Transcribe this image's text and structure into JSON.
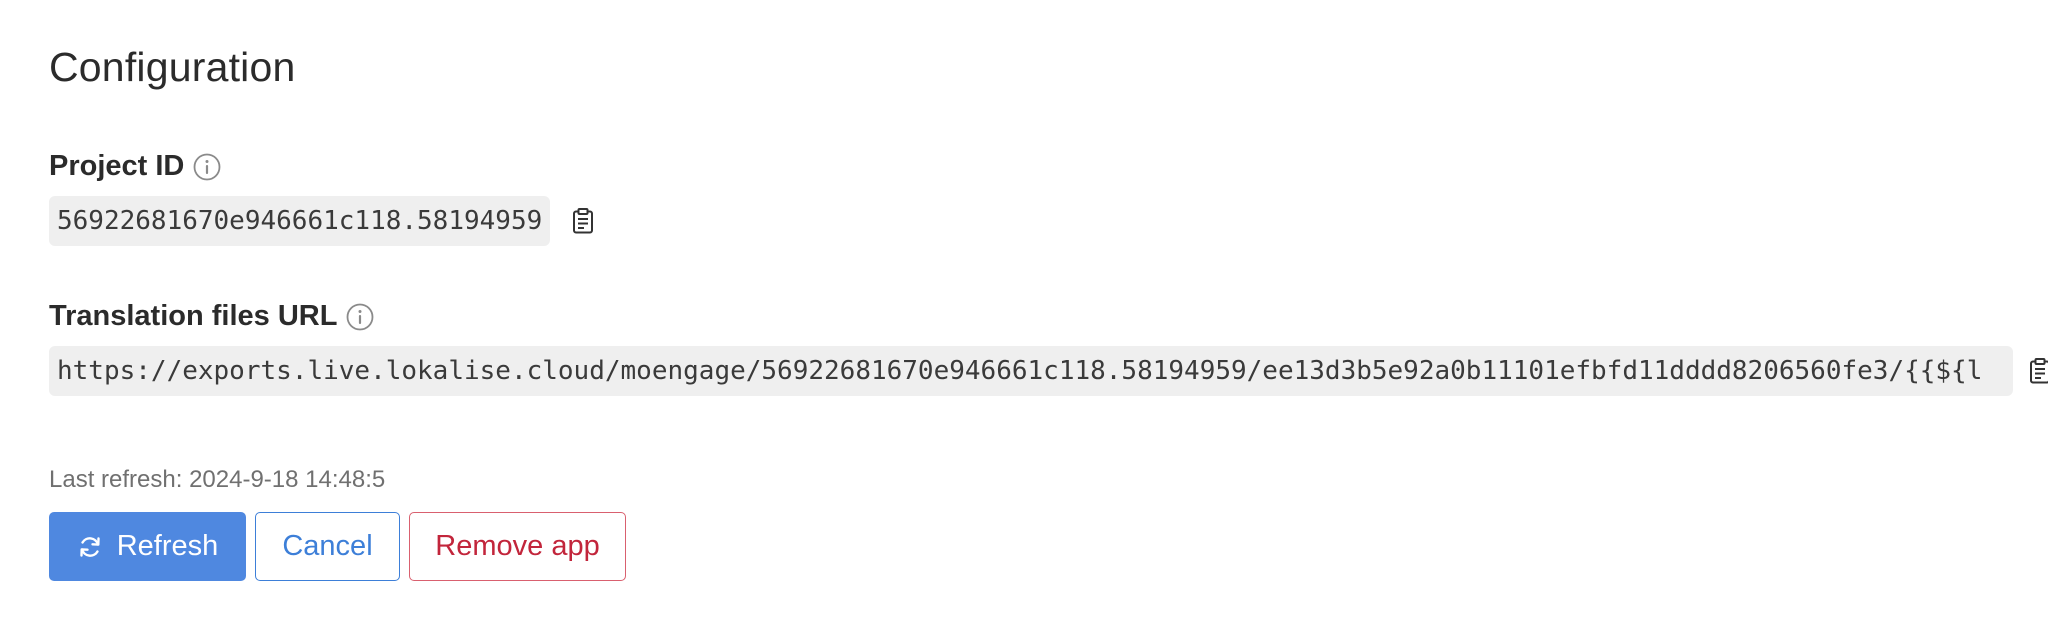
{
  "title": "Configuration",
  "project_id": {
    "label": "Project ID",
    "value": "56922681670e946661c118.58194959"
  },
  "translation_url": {
    "label": "Translation files URL",
    "value": "https://exports.live.lokalise.cloud/moengage/56922681670e946661c118.58194959/ee13d3b5e92a0b11101efbfd11dddd8206560fe3/{{${l"
  },
  "last_refresh": "Last refresh: 2024-9-18 14:48:5",
  "buttons": {
    "refresh": "Refresh",
    "cancel": "Cancel",
    "remove": "Remove app"
  },
  "colors": {
    "primary": "#4f88e0",
    "secondary": "#3d7fd8",
    "danger": "#c2253b",
    "code_bg": "#efefef"
  },
  "icons": {
    "info": "info-circle-icon",
    "copy": "clipboard-icon",
    "refresh": "refresh-icon"
  }
}
